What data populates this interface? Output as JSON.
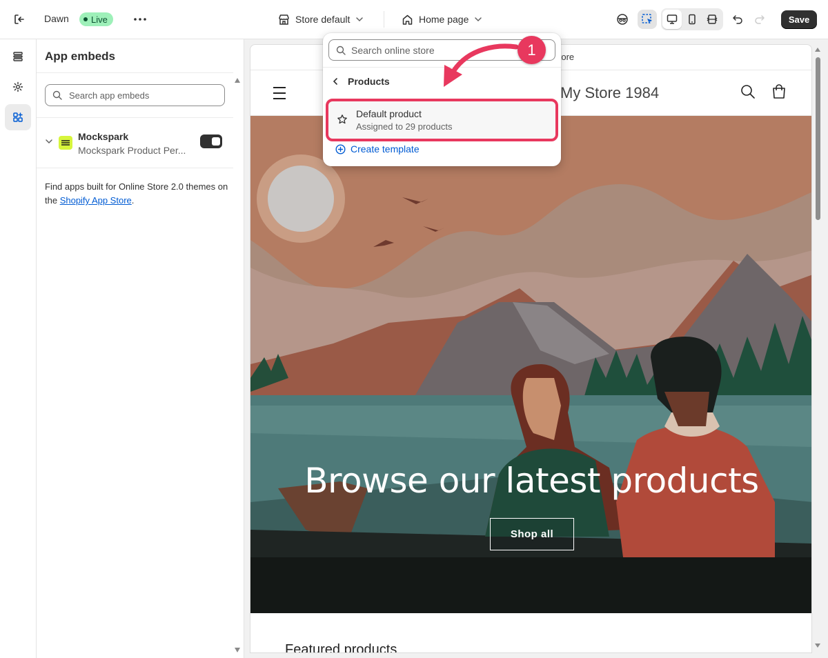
{
  "topbar": {
    "theme_name": "Dawn",
    "live_label": "Live",
    "store_selector": "Store default",
    "page_selector": "Home page",
    "save_label": "Save"
  },
  "panel": {
    "title": "App embeds",
    "search_placeholder": "Search app embeds",
    "app": {
      "name": "Mockspark",
      "subtitle": "Mockspark Product Per...",
      "enabled": true
    },
    "find_text": "Find apps built for Online Store 2.0 themes on the ",
    "find_link": "Shopify App Store",
    "find_suffix": "."
  },
  "preview": {
    "announcement": "Welcome to our store",
    "store_name": "My Store 1984",
    "hero_title": "Browse our latest products",
    "shop_all": "Shop all",
    "featured": "Featured products"
  },
  "popover": {
    "search_placeholder": "Search online store",
    "back_label": "Products",
    "item_title": "Default product",
    "item_subtitle": "Assigned to 29 products",
    "create_label": "Create template"
  },
  "annotation": {
    "step": "1"
  },
  "colors": {
    "accent": "#e8385e",
    "link": "#005bd3",
    "live_badge": "#9ef0b9",
    "primary_button": "#303030"
  }
}
